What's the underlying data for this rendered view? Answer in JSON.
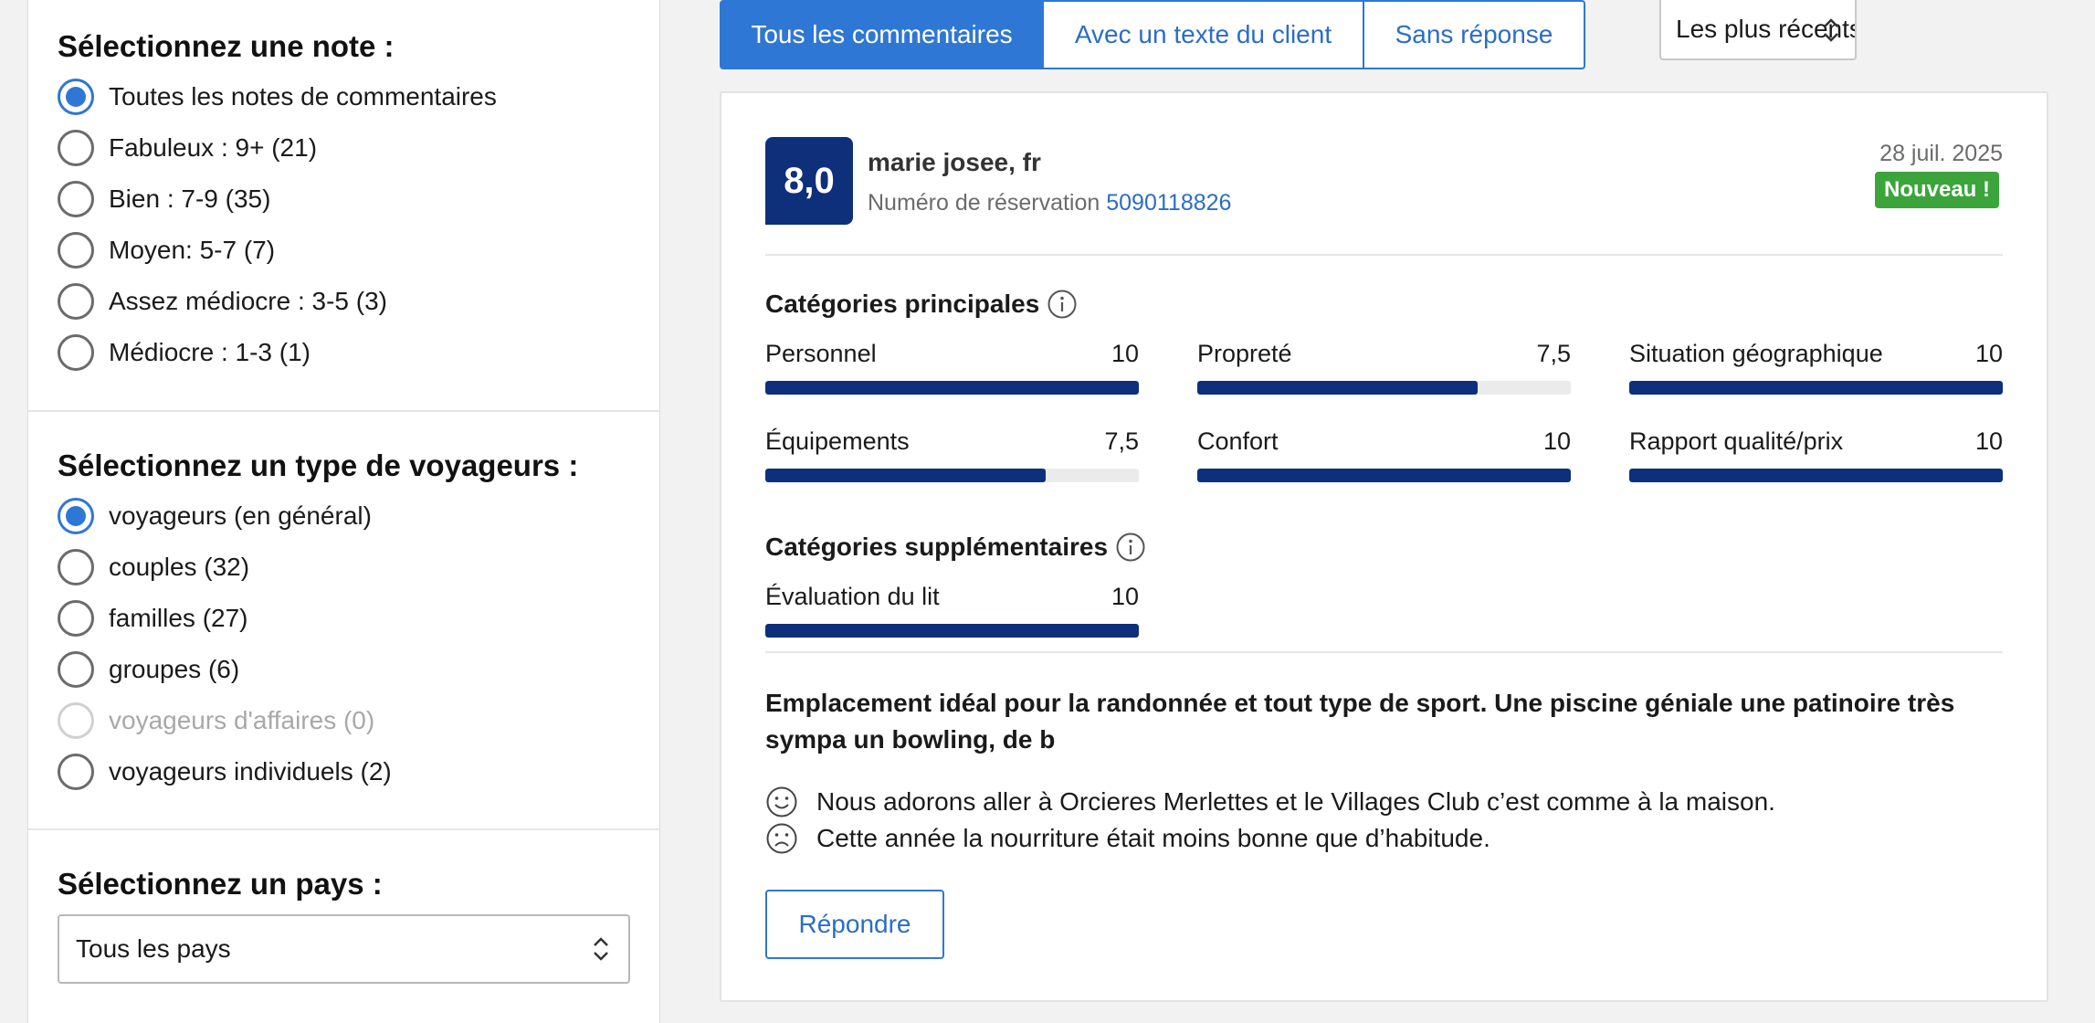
{
  "filters": {
    "rating": {
      "heading": "Sélectionnez une note :",
      "options": [
        {
          "label": "Toutes les notes de commentaires"
        },
        {
          "label": "Fabuleux : 9+ (21)"
        },
        {
          "label": "Bien : 7-9 (35)"
        },
        {
          "label": "Moyen: 5-7 (7)"
        },
        {
          "label": "Assez médiocre : 3-5 (3)"
        },
        {
          "label": "Médiocre : 1-3 (1)"
        }
      ],
      "selected_index": 0
    },
    "traveler_type": {
      "heading": "Sélectionnez un type de voyageurs :",
      "options": [
        {
          "label": "voyageurs (en général)"
        },
        {
          "label": "couples (32)"
        },
        {
          "label": "familles (27)"
        },
        {
          "label": "groupes (6)"
        },
        {
          "label": "voyageurs d'affaires (0)"
        },
        {
          "label": "voyageurs individuels (2)"
        }
      ],
      "selected_index": 0,
      "disabled_index": 4
    },
    "country": {
      "heading": "Sélectionnez un pays :",
      "value": "Tous les pays"
    }
  },
  "tabs": [
    {
      "label": "Tous les commentaires",
      "active": true
    },
    {
      "label": "Avec un texte du client",
      "active": false
    },
    {
      "label": "Sans réponse",
      "active": false
    }
  ],
  "sort": {
    "value": "Les plus récents en premie"
  },
  "review": {
    "score": "8,0",
    "reviewer": "marie josee, fr",
    "booking_label": "Numéro de réservation",
    "booking_number": "5090118826",
    "date": "28 juil. 2025",
    "badge": "Nouveau !",
    "main_categories_heading": "Catégories principales",
    "main_categories": [
      {
        "name": "Personnel",
        "score": "10",
        "fraction": 1.0
      },
      {
        "name": "Propreté",
        "score": "7,5",
        "fraction": 0.75
      },
      {
        "name": "Situation géographique",
        "score": "10",
        "fraction": 1.0
      },
      {
        "name": "Équipements",
        "score": "7,5",
        "fraction": 0.75
      },
      {
        "name": "Confort",
        "score": "10",
        "fraction": 1.0
      },
      {
        "name": "Rapport qualité/prix",
        "score": "10",
        "fraction": 1.0
      }
    ],
    "extra_categories_heading": "Catégories supplémentaires",
    "extra_categories": [
      {
        "name": "Évaluation du lit",
        "score": "10",
        "fraction": 1.0
      }
    ],
    "title": "Emplacement idéal pour la randonnée et tout type de sport. Une piscine géniale une patinoire très sympa un bowling, de b",
    "positive": "Nous adorons aller à Orcieres Merlettes et le Villages Club c’est comme à la maison.",
    "negative": "Cette année la nourriture était moins bonne que d’habitude.",
    "reply_label": "Répondre"
  },
  "colors": {
    "accent": "#2f77d4",
    "score_navy": "#0e2f7a",
    "new_badge": "#3ba53b"
  },
  "icons": {
    "info": "info-icon",
    "positive": "smiley-icon",
    "negative": "frown-icon",
    "select": "up-down-chevron-icon"
  }
}
